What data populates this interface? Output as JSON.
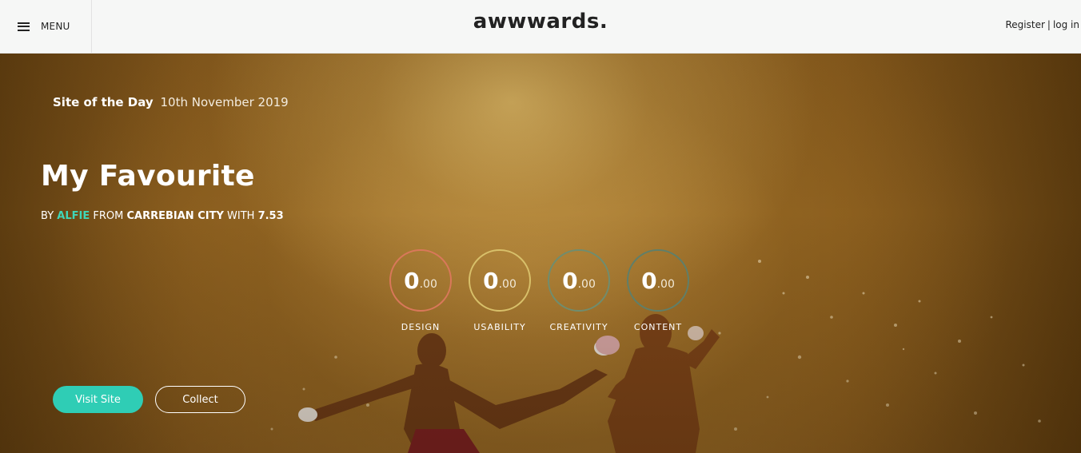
{
  "header": {
    "menu_label": "MENU",
    "logo_text": "awwwards.",
    "register_label": "Register",
    "separator": "|",
    "login_label": "log in"
  },
  "hero": {
    "badge": "Site of the Day",
    "date": "10th November 2019",
    "title": "My Favourite",
    "byline": {
      "by": "BY",
      "author": "ALFIE",
      "from": "FROM",
      "location": "CARREBIAN CITY",
      "with": "WITH",
      "score": "7.53"
    },
    "scores": [
      {
        "category": "DESIGN",
        "whole": "0",
        "decimal": ".00",
        "color": "#d9785a"
      },
      {
        "category": "USABILITY",
        "whole": "0",
        "decimal": ".00",
        "color": "#d8c06a"
      },
      {
        "category": "CREATIVITY",
        "whole": "0",
        "decimal": ".00",
        "color": "#6f8d6f"
      },
      {
        "category": "CONTENT",
        "whole": "0",
        "decimal": ".00",
        "color": "#5f7f6a"
      }
    ],
    "buttons": {
      "visit": "Visit Site",
      "collect": "Collect"
    }
  },
  "colors": {
    "accent": "#2fcdb5",
    "author": "#3fd6b8"
  }
}
